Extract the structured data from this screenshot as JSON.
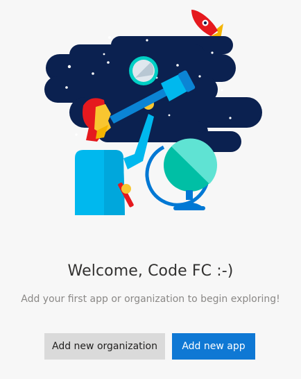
{
  "welcome": {
    "title": "Welcome, Code FC :-)",
    "subtitle": "Add your first app or organization to begin exploring!"
  },
  "actions": {
    "add_organization_label": "Add new organization",
    "add_app_label": "Add new app"
  },
  "colors": {
    "page_background": "#f7f7f7",
    "primary_button": "#0f78d4",
    "secondary_button": "#dadada",
    "space_navy": "#0b2150",
    "accent_red": "#e5191e",
    "accent_cyan": "#00b8ee",
    "globe_teal": "#00bfa5"
  },
  "illustration": {
    "icon": "space-explorer-illustration"
  }
}
